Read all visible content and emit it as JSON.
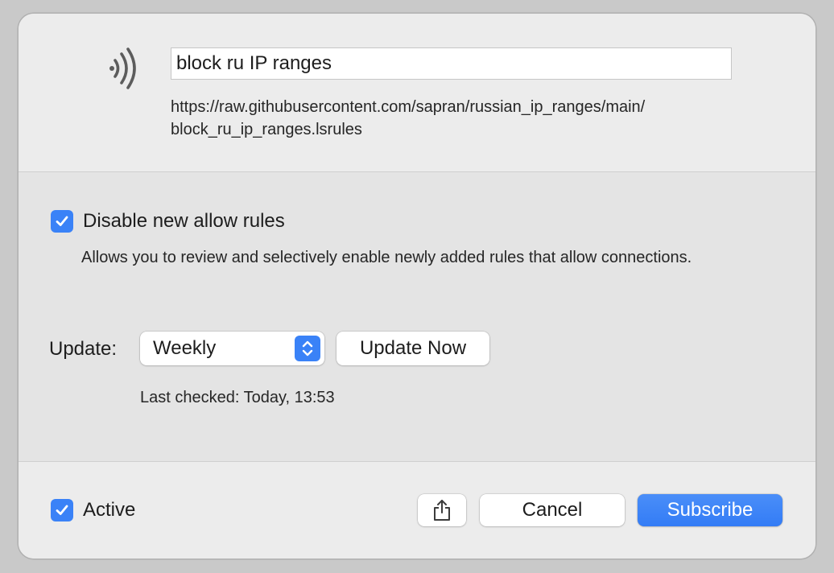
{
  "header": {
    "icon": "signal-broadcast-icon",
    "name_value": "block ru IP ranges",
    "url": "https://raw.githubusercontent.com/sapran/russian_ip_ranges/main/\nblock_ru_ip_ranges.lsrules"
  },
  "options": {
    "disable_new_allow_rules": {
      "checked": true,
      "label": "Disable new allow rules",
      "description": "Allows you to review and selectively enable newly added rules that allow connections."
    },
    "update": {
      "label": "Update:",
      "selected": "Weekly",
      "update_now_label": "Update Now",
      "last_checked": "Last checked: Today, 13:53"
    }
  },
  "footer": {
    "active": {
      "checked": true,
      "label": "Active"
    },
    "share_icon": "share-icon",
    "cancel_label": "Cancel",
    "subscribe_label": "Subscribe"
  },
  "colors": {
    "accent": "#3a82f7",
    "dialog_background": "#e8e8e8"
  }
}
